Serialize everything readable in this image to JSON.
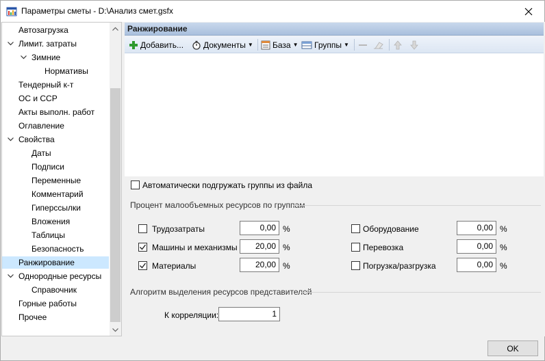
{
  "window": {
    "title": "Параметры сметы - D:\\Анализ смет.gsfx"
  },
  "tree": {
    "items": [
      {
        "label": "Автозагрузка"
      },
      {
        "label": "Лимит. затраты"
      },
      {
        "label": "Зимние"
      },
      {
        "label": "Нормативы"
      },
      {
        "label": "Тендерный к-т"
      },
      {
        "label": "ОС и ССР"
      },
      {
        "label": "Акты выполн. работ"
      },
      {
        "label": "Оглавление"
      },
      {
        "label": "Свойства"
      },
      {
        "label": "Даты"
      },
      {
        "label": "Подписи"
      },
      {
        "label": "Переменные"
      },
      {
        "label": "Комментарий"
      },
      {
        "label": "Гиперссылки"
      },
      {
        "label": "Вложения"
      },
      {
        "label": "Таблицы"
      },
      {
        "label": "Безопасность"
      },
      {
        "label": "Ранжирование"
      },
      {
        "label": "Однородные ресурсы"
      },
      {
        "label": "Справочник"
      },
      {
        "label": "Горные работы"
      },
      {
        "label": "Прочее"
      }
    ],
    "selected": "Ранжирование"
  },
  "panel": {
    "header": "Ранжирование",
    "toolbar": {
      "add": "Добавить...",
      "documents": "Документы",
      "base": "База",
      "groups": "Группы"
    },
    "auto_load_label": "Автоматически подгружать группы из файла",
    "auto_load_checked": false,
    "percent_group_title": "Процент малообъемных ресурсов по группам",
    "left_resources": [
      {
        "label": "Трудозатраты",
        "checked": false,
        "value": "0,00",
        "unit": "%"
      },
      {
        "label": "Машины и механизмы",
        "checked": true,
        "value": "20,00",
        "unit": "%"
      },
      {
        "label": "Материалы",
        "checked": true,
        "value": "20,00",
        "unit": "%"
      }
    ],
    "right_resources": [
      {
        "label": "Оборудование",
        "checked": false,
        "value": "0,00",
        "unit": "%"
      },
      {
        "label": "Перевозка",
        "checked": false,
        "value": "0,00",
        "unit": "%"
      },
      {
        "label": "Погрузка/разгрузка",
        "checked": false,
        "value": "0,00",
        "unit": "%"
      }
    ],
    "algorithm_title": "Алгоритм выделения ресурсов представителей",
    "correlation_label": "К корреляции:",
    "correlation_value": "1"
  },
  "footer": {
    "ok_label": "OK"
  },
  "colors": {
    "selection": "#cce8ff",
    "header_gradient_top": "#c9d8ec",
    "header_gradient_bottom": "#a9c0dd"
  }
}
